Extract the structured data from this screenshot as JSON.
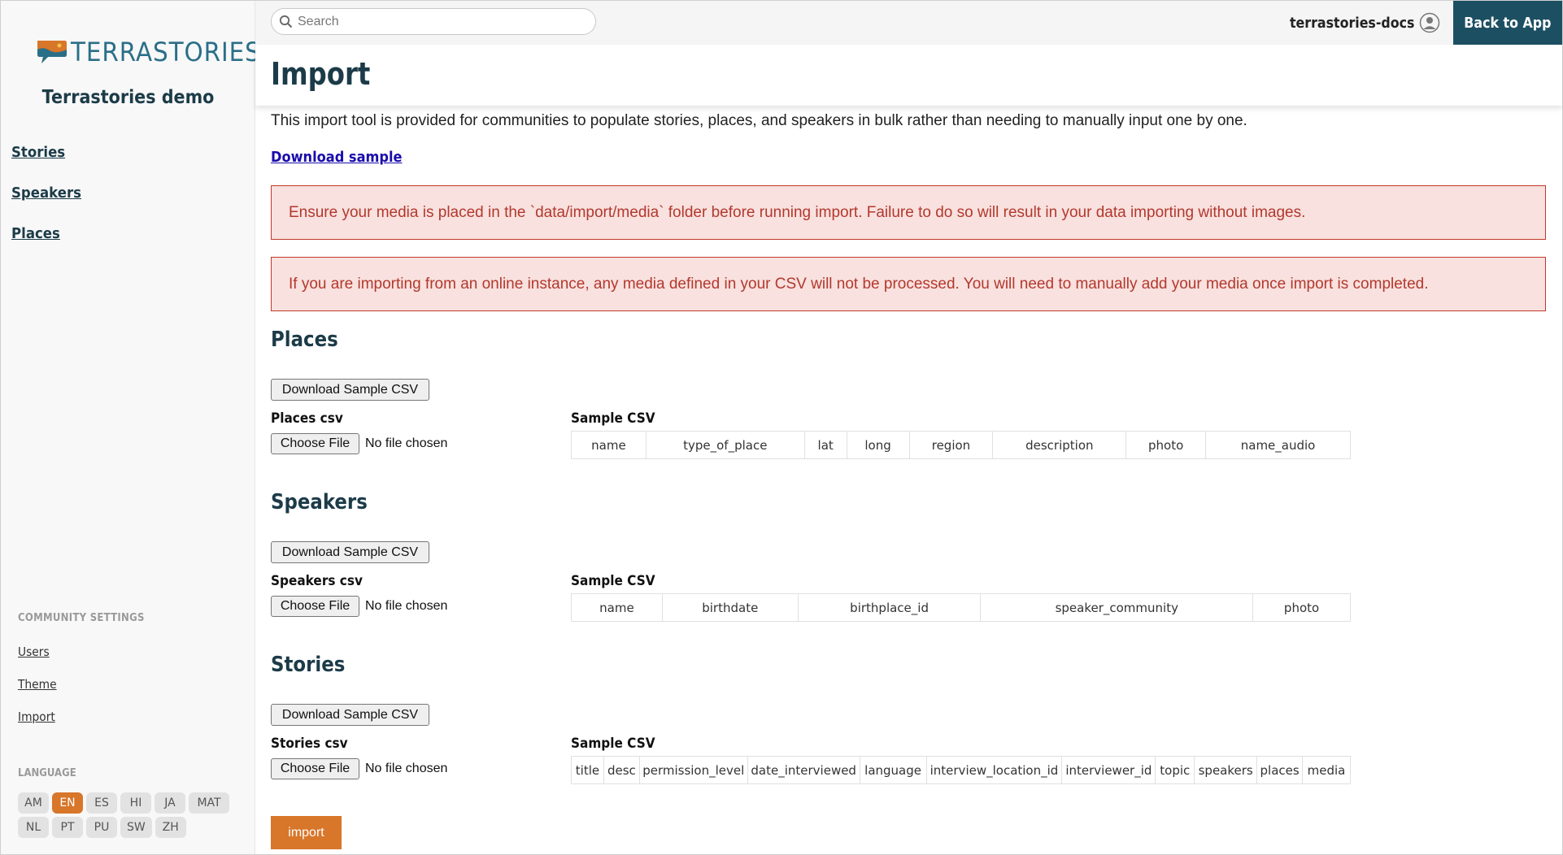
{
  "sidebar": {
    "logo_text": "TERRASTORIES",
    "site_title": "Terrastories demo",
    "nav": [
      "Stories",
      "Speakers",
      "Places"
    ],
    "community_settings_heading": "COMMUNITY SETTINGS",
    "community_links": [
      "Users",
      "Theme",
      "Import"
    ],
    "language_heading": "LANGUAGE",
    "languages": [
      "AM",
      "EN",
      "ES",
      "HI",
      "JA",
      "MAT",
      "NL",
      "PT",
      "PU",
      "SW",
      "ZH"
    ],
    "active_language": "EN"
  },
  "topbar": {
    "search_placeholder": "Search",
    "username": "terrastories-docs",
    "back_button": "Back to App"
  },
  "page": {
    "title": "Import",
    "intro": "This import tool is provided for communities to populate stories, places, and speakers in bulk rather than needing to manually input one by one.",
    "download_sample": "Download sample",
    "alert_media_folder": "Ensure your media is placed in the `data/import/media` folder before running import. Failure to do so will result in your data importing without images.",
    "alert_online": "If you are importing from an online instance, any media defined in your CSV will not be processed. You will need to manually add your media once import is completed.",
    "import_button": "import"
  },
  "common": {
    "download_sample_csv": "Download Sample CSV",
    "choose_file": "Choose File",
    "no_file": "No file chosen",
    "sample_csv_label": "Sample CSV"
  },
  "sections": {
    "places": {
      "title": "Places",
      "csv_label": "Places csv",
      "columns": [
        "name",
        "type_of_place",
        "lat",
        "long",
        "region",
        "description",
        "photo",
        "name_audio"
      ]
    },
    "speakers": {
      "title": "Speakers",
      "csv_label": "Speakers csv",
      "columns": [
        "name",
        "birthdate",
        "birthplace_id",
        "speaker_community",
        "photo"
      ]
    },
    "stories": {
      "title": "Stories",
      "csv_label": "Stories csv",
      "columns": [
        "title",
        "desc",
        "permission_level",
        "date_interviewed",
        "language",
        "interview_location_id",
        "interviewer_id",
        "topic",
        "speakers",
        "places",
        "media"
      ]
    }
  },
  "colors": {
    "brand_dark": "#1d4f63",
    "accent_orange": "#d8762a",
    "alert_bg": "#f8e1de",
    "alert_text": "#b3382e",
    "heading": "#1c3b48"
  }
}
